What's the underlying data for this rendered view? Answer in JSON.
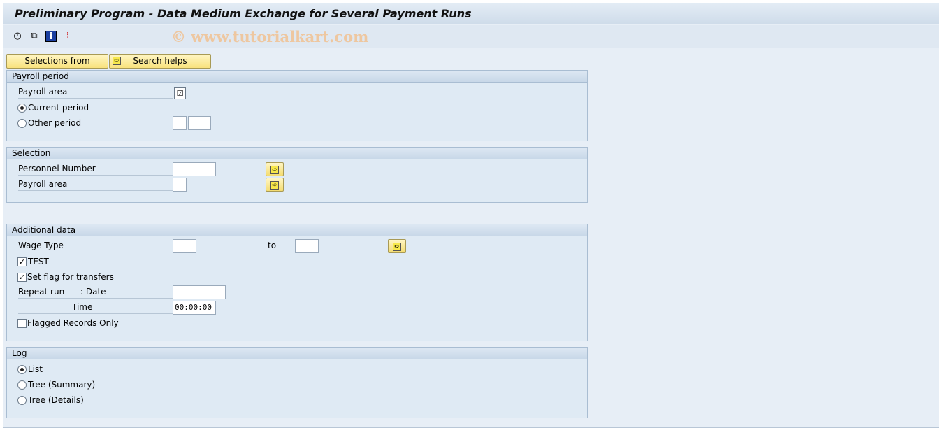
{
  "title": "Preliminary Program - Data Medium Exchange for Several Payment Runs",
  "watermark": "© www.tutorialkart.com",
  "toolbar": {
    "icons": [
      "execute-icon",
      "get-variant-icon",
      "info-icon",
      "selection-options-icon"
    ]
  },
  "buttons": {
    "selections_from": "Selections from",
    "search_helps": "Search helps"
  },
  "payroll_period": {
    "title": "Payroll period",
    "payroll_area": "Payroll area",
    "payroll_area_checked": true,
    "current_period": "Current period",
    "other_period": "Other period",
    "selected": "current_period"
  },
  "selection": {
    "title": "Selection",
    "personnel_number": "Personnel Number",
    "payroll_area": "Payroll area"
  },
  "additional": {
    "title": "Additional data",
    "wage_type": "Wage Type",
    "to": "to",
    "test": "TEST",
    "test_checked": true,
    "set_flag": "Set flag for transfers",
    "set_flag_checked": true,
    "repeat_run": "Repeat run",
    "date": ": Date",
    "time": "Time",
    "time_value": "00:00:00",
    "flagged": "Flagged Records Only",
    "flagged_checked": false
  },
  "log": {
    "title": "Log",
    "list": "List",
    "tree_summary": "Tree (Summary)",
    "tree_details": "Tree (Details)",
    "selected": "list"
  }
}
